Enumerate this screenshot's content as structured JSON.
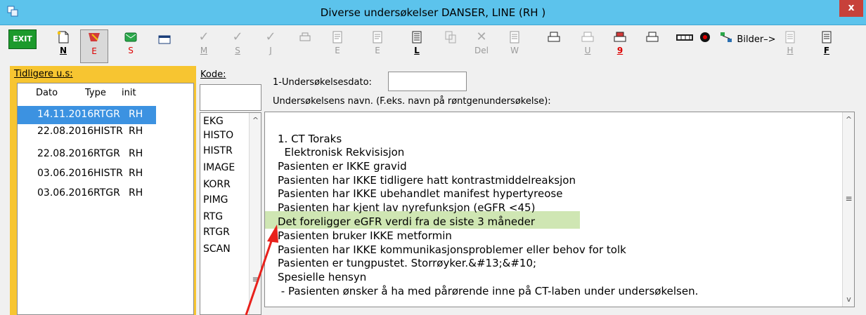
{
  "window": {
    "title": "Diverse undersøkelser DANSER, LINE (RH  )",
    "close": "x"
  },
  "toolbar": {
    "exit": "EXIT",
    "n": "N",
    "e": "E",
    "s": "S",
    "m": "M",
    "s2": "S",
    "j": "J",
    "e2": "E",
    "e3": "E",
    "l": "L",
    "del": "Del",
    "w": "W",
    "u": "U",
    "nine": "9",
    "bilder": "Bilder–>",
    "h": "H",
    "f": "F"
  },
  "left": {
    "header": "Tidligere u.s:",
    "columns": [
      "Dato",
      "Type",
      "init"
    ],
    "rows": [
      {
        "date": "14.11.2016",
        "type": "RTGR",
        "init": "RH"
      },
      {
        "date": "22.08.2016",
        "type": "HISTR",
        "init": "RH"
      },
      {
        "date": "22.08.2016",
        "type": "RTGR",
        "init": "RH"
      },
      {
        "date": "03.06.2016",
        "type": "HISTR",
        "init": "RH"
      },
      {
        "date": "03.06.2016",
        "type": "RTGR",
        "init": "RH"
      }
    ]
  },
  "kode": {
    "label": "Kode:",
    "items": [
      "EKG",
      "HISTO",
      "HISTR",
      "IMAGE",
      "KORR",
      "PIMG",
      "RTG",
      "RTGR",
      "SCAN"
    ]
  },
  "form": {
    "date_label": "1-Undersøkelsesdato:",
    "name_label": "Undersøkelsens navn. (F.eks. navn på røntgenundersøkelse):",
    "lines": [
      "1. CT Toraks",
      "  Elektronisk Rekvisisjon",
      "Pasienten er IKKE gravid",
      "Pasienten har IKKE tidligere hatt kontrastmiddelreaksjon",
      "Pasienten har IKKE ubehandlet manifest hypertyreose",
      "Pasienten har kjent lav nyrefunksjon (eGFR <45)",
      "Det foreligger eGFR verdi fra de siste 3 måneder",
      "Pasienten bruker IKKE metformin",
      "Pasienten har IKKE kommunikasjonsproblemer eller behov for tolk",
      "Pasienten er tungpustet. Storrøyker.&#13;&#10;",
      "Spesielle hensyn",
      " - Pasienten ønsker å ha med pårørende inne på CT-laben under undersøkelsen."
    ]
  },
  "colors": {
    "titlebar": "#5cc3ec",
    "left_panel": "#f7c531",
    "selection": "#3c92e1",
    "highlight": "#cfe6b3",
    "annotation_arrow": "#e8211c"
  }
}
